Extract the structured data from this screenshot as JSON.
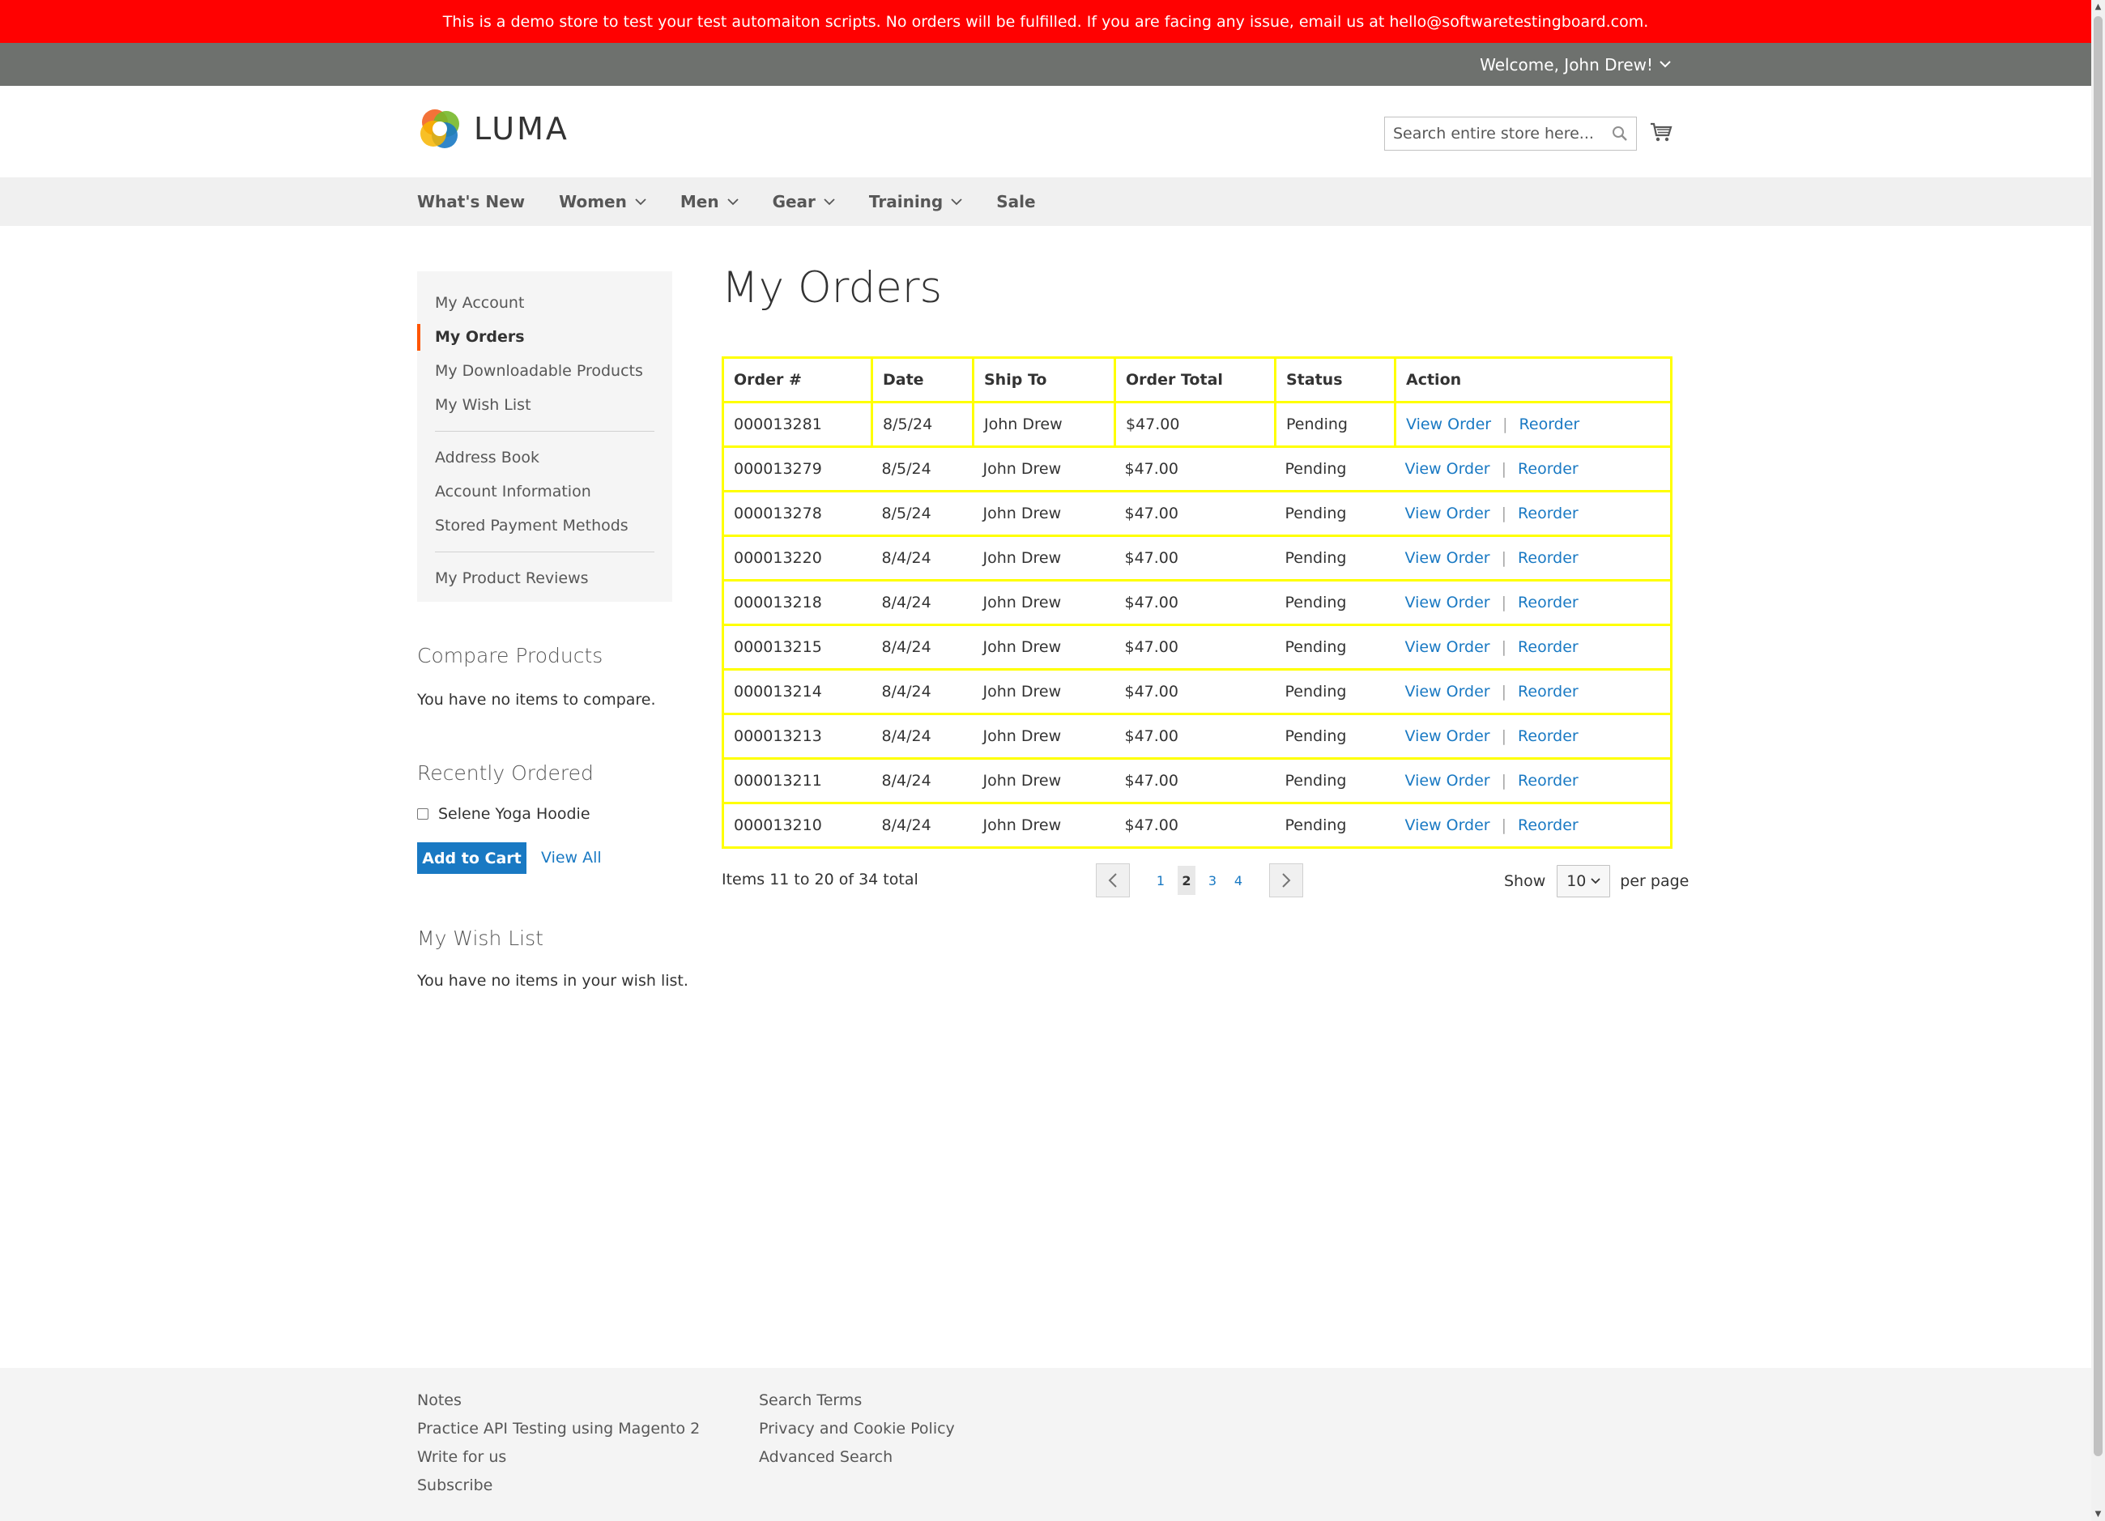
{
  "banner": {
    "text": "This is a demo store to test your test automaiton scripts. No orders will be fulfilled. If you are facing any issue, email us at hello@softwaretestingboard.com."
  },
  "header": {
    "welcome": "Welcome, John Drew!",
    "logo_text": "LUMA",
    "search_placeholder": "Search entire store here..."
  },
  "nav": {
    "items": [
      {
        "label": "What's New",
        "has_dropdown": false
      },
      {
        "label": "Women",
        "has_dropdown": true
      },
      {
        "label": "Men",
        "has_dropdown": true
      },
      {
        "label": "Gear",
        "has_dropdown": true
      },
      {
        "label": "Training",
        "has_dropdown": true
      },
      {
        "label": "Sale",
        "has_dropdown": false
      }
    ]
  },
  "sidebar": {
    "items": [
      {
        "label": "My Account"
      },
      {
        "label": "My Orders",
        "active": true
      },
      {
        "label": "My Downloadable Products"
      },
      {
        "label": "My Wish List"
      },
      {
        "label": "Address Book"
      },
      {
        "label": "Account Information"
      },
      {
        "label": "Stored Payment Methods"
      },
      {
        "label": "My Product Reviews"
      }
    ],
    "compare_title": "Compare Products",
    "compare_text": "You have no items to compare.",
    "recent_title": "Recently Ordered",
    "recent_item": "Selene Yoga Hoodie",
    "add_to_cart": "Add to Cart",
    "view_all": "View All",
    "wishlist_title": "My Wish List",
    "wishlist_text": "You have no items in your wish list."
  },
  "main": {
    "title": "My Orders",
    "columns": [
      "Order #",
      "Date",
      "Ship To",
      "Order Total",
      "Status",
      "Action"
    ],
    "view_order_label": "View Order",
    "reorder_label": "Reorder",
    "rows": [
      [
        "000013281",
        "8/5/24",
        "John Drew",
        "$47.00",
        "Pending"
      ],
      [
        "000013279",
        "8/5/24",
        "John Drew",
        "$47.00",
        "Pending"
      ],
      [
        "000013278",
        "8/5/24",
        "John Drew",
        "$47.00",
        "Pending"
      ],
      [
        "000013220",
        "8/4/24",
        "John Drew",
        "$47.00",
        "Pending"
      ],
      [
        "000013218",
        "8/4/24",
        "John Drew",
        "$47.00",
        "Pending"
      ],
      [
        "000013215",
        "8/4/24",
        "John Drew",
        "$47.00",
        "Pending"
      ],
      [
        "000013214",
        "8/4/24",
        "John Drew",
        "$47.00",
        "Pending"
      ],
      [
        "000013213",
        "8/4/24",
        "John Drew",
        "$47.00",
        "Pending"
      ],
      [
        "000013211",
        "8/4/24",
        "John Drew",
        "$47.00",
        "Pending"
      ],
      [
        "000013210",
        "8/4/24",
        "John Drew",
        "$47.00",
        "Pending"
      ]
    ],
    "toolbar_amount": "Items 11 to 20 of 34 total",
    "pages": [
      "1",
      "2",
      "3",
      "4"
    ],
    "current_page": "2",
    "show_label": "Show",
    "limiter_value": "10",
    "per_page_label": "per page"
  },
  "footer": {
    "col1": [
      "Notes",
      "Practice API Testing using Magento 2",
      "Write for us",
      "Subscribe"
    ],
    "col2": [
      "Search Terms",
      "Privacy and Cookie Policy",
      "Advanced Search"
    ]
  },
  "colors": {
    "banner": "#ff0101",
    "panel": "#6e716e",
    "link": "#1979c3",
    "table_highlight": "#ffff00",
    "active_marker": "#ff5501"
  }
}
